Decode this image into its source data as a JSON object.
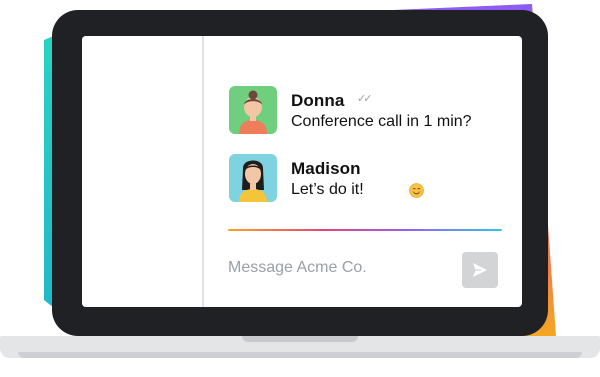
{
  "conversation": {
    "messages": [
      {
        "sender": "Donna",
        "text": "Conference call in 1 min?",
        "status_icon": "double-check-icon",
        "read_marks": "✓✓",
        "avatar": {
          "bg": "#6fcf7f",
          "shirt": "#f07d5a",
          "hair": "#6b4a3a",
          "skin": "#f3c6a6"
        }
      },
      {
        "sender": "Madison",
        "text": "Let’s do it!",
        "emoji": "smiling-face-emoji",
        "avatar": {
          "bg": "#7fd3e0",
          "shirt": "#f4c43a",
          "hair": "#1e1e1e",
          "skin": "#f3c6a6"
        }
      }
    ]
  },
  "composer": {
    "placeholder": "Message Acme Co.",
    "send_icon": "send-arrow-icon"
  },
  "colors": {
    "accent_gradient": [
      "#f5a623",
      "#e8437a",
      "#9b5cf6",
      "#2ec7e6"
    ],
    "bezel": "#202124",
    "send_button": "#d3d4d6"
  }
}
